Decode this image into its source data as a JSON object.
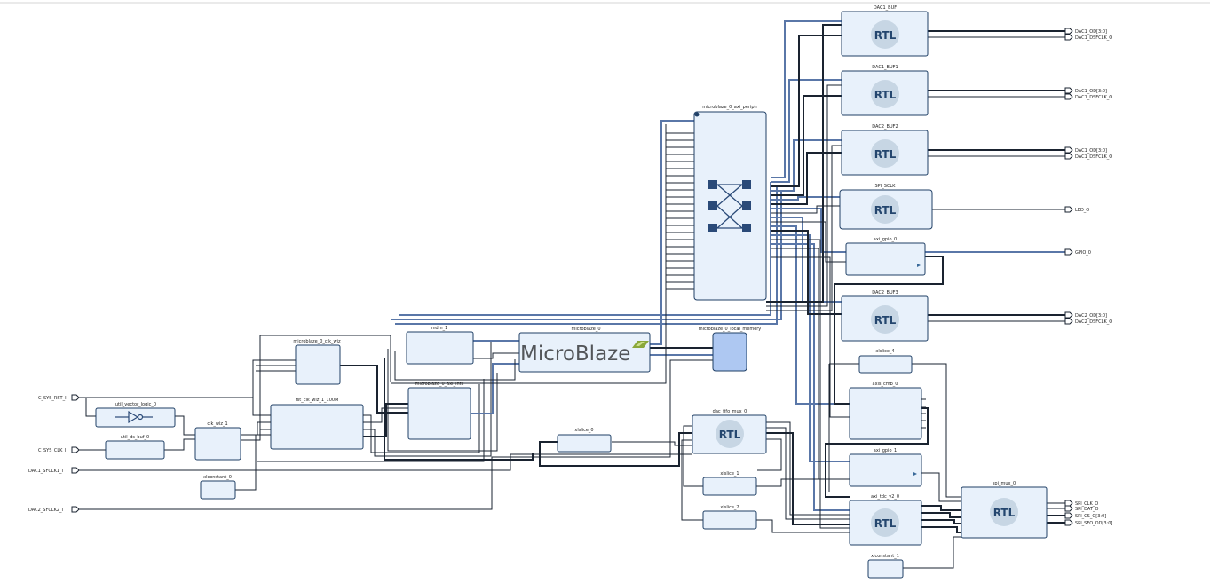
{
  "blocks": {
    "dac_buf0": "DAC1_BUF",
    "dac_buf1": "DAC1_BUF1",
    "dac_buf2": "DAC2_BUF2",
    "spi_sclk": "SPI_SCLK",
    "axi_gpio0": "axi_gpio_0",
    "dac_buf3": "DAC2_BUF3",
    "xlslice4": "xlslice_4",
    "axis_cmb": "axis_cmb_0",
    "axi_gpio1": "axi_gpio_1",
    "axi_tdc": "axi_tdc_v2_0",
    "spi_mux": "spi_mux_0",
    "xlconst1": "xlconstant_1",
    "axi_periph": "microblaze_0_axi_periph",
    "mdm": "mdm_1",
    "microblaze": "microblaze_0",
    "local_mem": "microblaze_0_local_memory",
    "clk_wiz": "microblaze_0_clk_wiz",
    "axi_intc": "microblaze_0_axi_intc",
    "util_vec": "util_vector_logic_0",
    "util_ds": "util_ds_buf_0",
    "clk_wiz_1": "clk_wiz_1",
    "rst_clk": "rst_clk_wiz_1_100M",
    "xlconst0": "xlconstant_0",
    "dac_fifo": "dac_fifo_mux_0",
    "xlslice0": "xlslice_0",
    "xlslice1": "xlslice_1",
    "xlslice2": "xlslice_2"
  },
  "ports_in": {
    "p1": "C_SYS_RST_I",
    "p2": "C_SYS_CLK_I",
    "p3": "DAC1_SFCLK1_I",
    "p4": "DAC2_SFCLK2_I"
  },
  "ports_out": {
    "o1a": "DAC1_OD[3:0]",
    "o1b": "DAC1_DSFCLK_O",
    "o2a": "DAC1_OD[3:0]",
    "o2b": "DAC1_DSFCLK_O",
    "o3a": "DAC1_OD[3:0]",
    "o3b": "DAC1_DSFCLK_O",
    "led": "LED_O",
    "gpio": "GPIO_0",
    "o4a": "DAC2_OD[3:0]",
    "o4b": "DAC2_DSFCLK_O",
    "spi_clk": "SPI_CLK_O",
    "spi_dat": "SPI_DAT_O",
    "spi_cs": "SPI_CS_O[3:0]",
    "spi_sfo": "SPI_SFO_OD[3:0]"
  },
  "ip": {
    "rtl": "RTL",
    "microblaze_logo": "MicroBlaze"
  },
  "colors": {
    "block_fill": "#e8f1fb",
    "block_stroke": "#1f3f66",
    "highlight_block": "#aec8f2",
    "bus": "#5a77a8",
    "wire": "#1a2330"
  }
}
